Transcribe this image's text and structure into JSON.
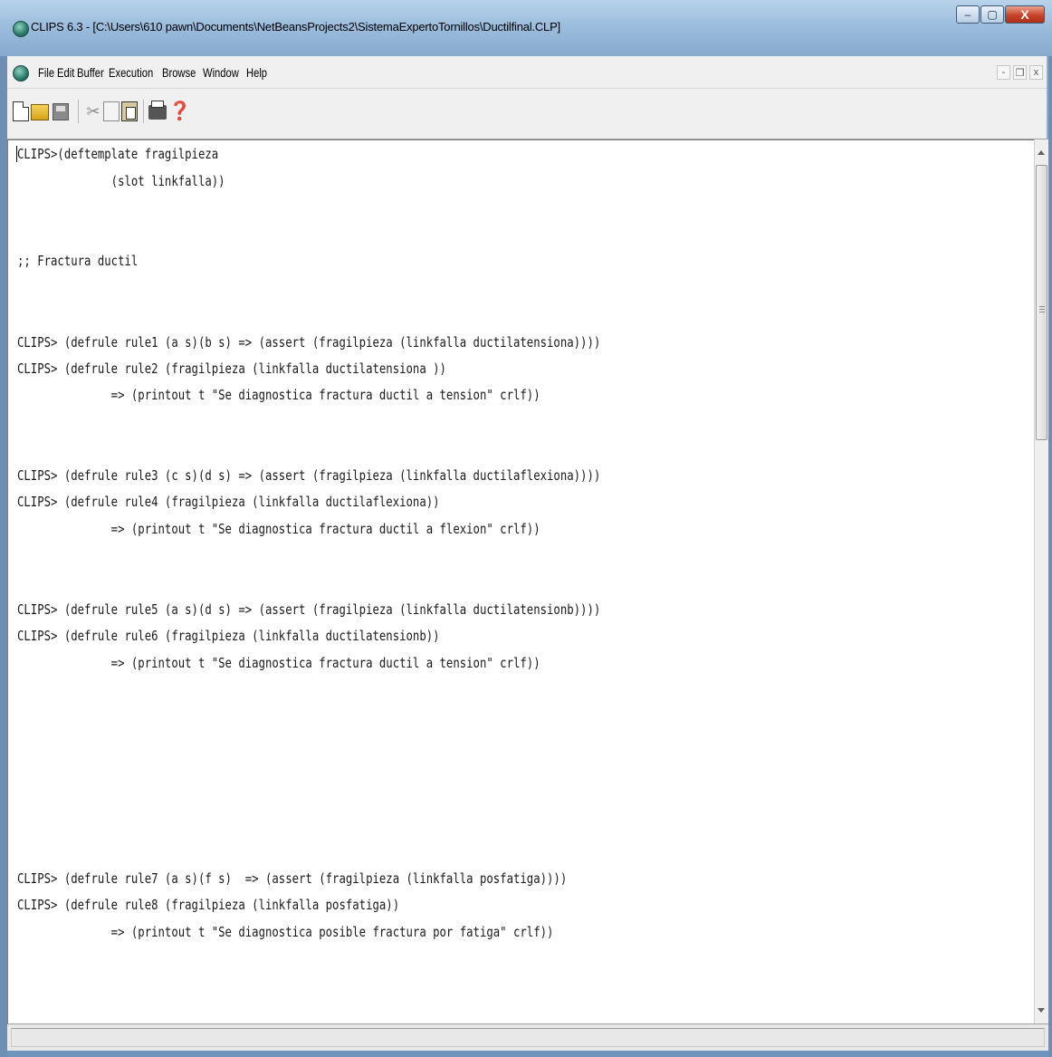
{
  "window": {
    "title": "CLIPS 6.3 - [C:\\Users\\610 pawn\\Documents\\NetBeansProjects2\\SistemaExpertoTornillos\\Ductilfinal.CLP]",
    "minimize_label": "–",
    "maximize_label": "▢",
    "close_label": "X"
  },
  "menubar": {
    "items": [
      "File",
      "Edit",
      "Buffer",
      "Execution",
      "Browse",
      "Window",
      "Help"
    ],
    "mdi_minimize": "-",
    "mdi_restore": "❐",
    "mdi_close": "x"
  },
  "toolbar": {
    "icons": [
      "new-file-icon",
      "open-folder-icon",
      "save-icon",
      "cut-icon",
      "copy-icon",
      "paste-icon",
      "print-icon",
      "context-help-icon"
    ],
    "cut_glyph": "✂",
    "help_glyph": "❓"
  },
  "editor": {
    "lines": [
      "CLIPS>(deftemplate fragilpieza",
      "              (slot linkfalla))",
      ";; Fractura ductil",
      "CLIPS> (defrule rule1 (a s)(b s) => (assert (fragilpieza (linkfalla ductilatensiona))))",
      "CLIPS> (defrule rule2 (fragilpieza (linkfalla ductilatensiona ))",
      "              => (printout t \"Se diagnostica fractura ductil a tension\" crlf))",
      "CLIPS> (defrule rule3 (c s)(d s) => (assert (fragilpieza (linkfalla ductilaflexiona))))",
      "CLIPS> (defrule rule4 (fragilpieza (linkfalla ductilaflexiona))",
      "              => (printout t \"Se diagnostica fractura ductil a flexion\" crlf))",
      "CLIPS> (defrule rule5 (a s)(d s) => (assert (fragilpieza (linkfalla ductilatensionb))))",
      "CLIPS> (defrule rule6 (fragilpieza (linkfalla ductilatensionb))",
      "              => (printout t \"Se diagnostica fractura ductil a tension\" crlf))",
      "CLIPS> (defrule rule7 (a s)(f s)  => (assert (fragilpieza (linkfalla posfatiga))))",
      "CLIPS> (defrule rule8 (fragilpieza (linkfalla posfatiga))",
      "              => (printout t \"Se diagnostica posible fractura por fatiga\" crlf))"
    ]
  },
  "scrollbar": {
    "position_fraction": 0.0,
    "visible_fraction": 0.33
  },
  "colors": {
    "titlebar": "#9cbddd",
    "close_button": "#c6432a",
    "editor_background": "#ffffff",
    "text": "#1a1a1a"
  }
}
